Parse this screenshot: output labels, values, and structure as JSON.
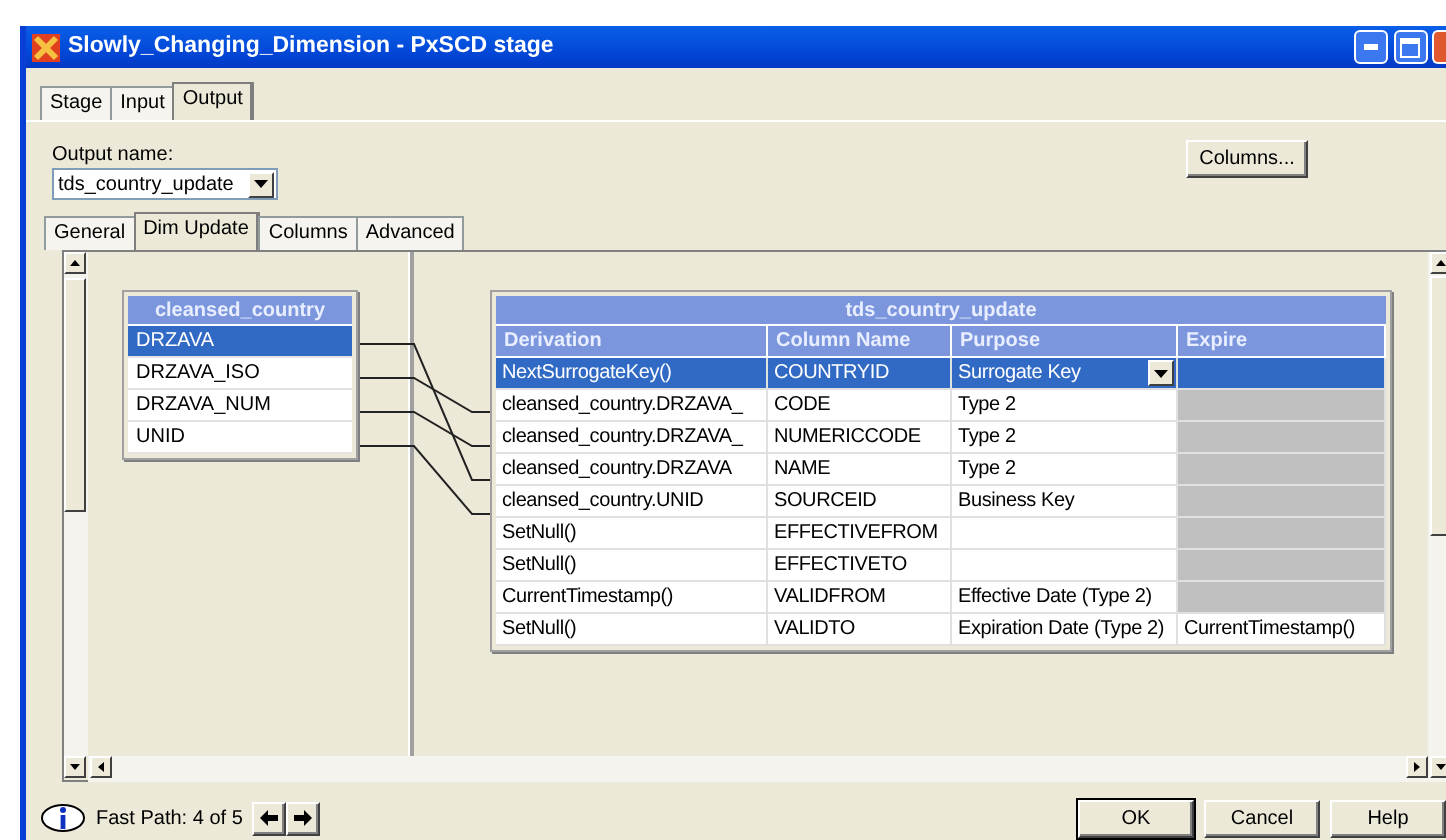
{
  "window": {
    "title": "Slowly_Changing_Dimension - PxSCD stage"
  },
  "tabs": [
    {
      "label": "Stage",
      "selected": false
    },
    {
      "label": "Input",
      "selected": false
    },
    {
      "label": "Output",
      "selected": true
    }
  ],
  "output_name": {
    "label": "Output name:",
    "value": "tds_country_update"
  },
  "columns_button": "Columns...",
  "inner_tabs": [
    {
      "label": "General",
      "selected": false
    },
    {
      "label": "Dim Update",
      "selected": true
    },
    {
      "label": "Columns",
      "selected": false
    },
    {
      "label": "Advanced",
      "selected": false
    }
  ],
  "source_table": {
    "title": "cleansed_country",
    "columns": [
      {
        "name": "DRZAVA",
        "selected": true
      },
      {
        "name": "DRZAVA_ISO",
        "selected": false
      },
      {
        "name": "DRZAVA_NUM",
        "selected": false
      },
      {
        "name": "UNID",
        "selected": false
      }
    ]
  },
  "target_table": {
    "title": "tds_country_update",
    "headers": [
      "Derivation",
      "Column Name",
      "Purpose",
      "Expire"
    ],
    "rows": [
      {
        "derivation": "NextSurrogateKey()",
        "column_name": "COUNTRYID",
        "purpose": "Surrogate Key",
        "expire": "",
        "selected": true,
        "expire_enabled": true
      },
      {
        "derivation": "cleansed_country.DRZAVA_",
        "column_name": "CODE",
        "purpose": "Type 2",
        "expire": "",
        "selected": false,
        "expire_enabled": false
      },
      {
        "derivation": "cleansed_country.DRZAVA_",
        "column_name": "NUMERICCODE",
        "purpose": "Type 2",
        "expire": "",
        "selected": false,
        "expire_enabled": false
      },
      {
        "derivation": "cleansed_country.DRZAVA",
        "column_name": "NAME",
        "purpose": "Type 2",
        "expire": "",
        "selected": false,
        "expire_enabled": false
      },
      {
        "derivation": "cleansed_country.UNID",
        "column_name": "SOURCEID",
        "purpose": "Business Key",
        "expire": "",
        "selected": false,
        "expire_enabled": false
      },
      {
        "derivation": "SetNull()",
        "column_name": "EFFECTIVEFROM",
        "purpose": "",
        "expire": "",
        "selected": false,
        "expire_enabled": false
      },
      {
        "derivation": "SetNull()",
        "column_name": "EFFECTIVETO",
        "purpose": "",
        "expire": "",
        "selected": false,
        "expire_enabled": false
      },
      {
        "derivation": "CurrentTimestamp()",
        "column_name": "VALIDFROM",
        "purpose": "Effective Date (Type 2)",
        "expire": "",
        "selected": false,
        "expire_enabled": false
      },
      {
        "derivation": "SetNull()",
        "column_name": "VALIDTO",
        "purpose": "Expiration Date (Type 2)",
        "expire": "CurrentTimestamp()",
        "selected": false,
        "expire_enabled": true
      }
    ]
  },
  "footer": {
    "fast_path": "Fast Path: 4 of 5",
    "buttons": [
      "OK",
      "Cancel",
      "Help"
    ]
  }
}
